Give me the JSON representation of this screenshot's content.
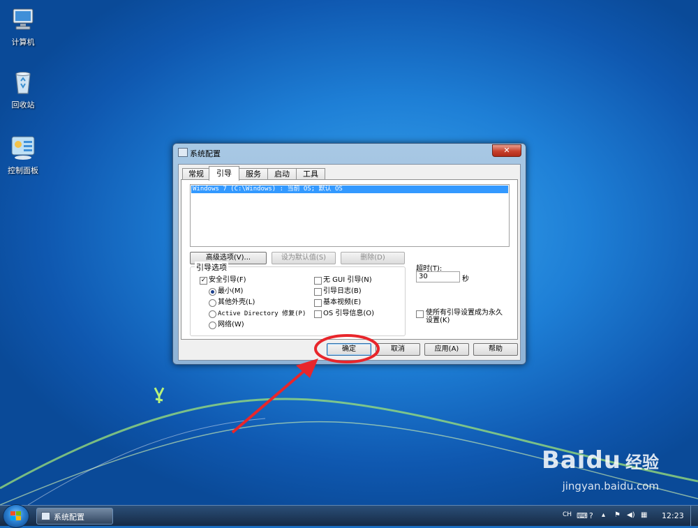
{
  "desktop": {
    "icons": [
      {
        "label": "计算机"
      },
      {
        "label": "回收站"
      },
      {
        "label": "控制面板"
      }
    ]
  },
  "dialog": {
    "title": "系统配置",
    "close": "✕",
    "tabs": [
      "常规",
      "引导",
      "服务",
      "启动",
      "工具"
    ],
    "active_tab": "引导",
    "os_entry": "Windows 7 (C:\\Windows) : 当前 OS; 默认 OS",
    "buttons": {
      "advanced": "高级选项(V)...",
      "set_default": "设为默认值(S)",
      "delete": "删除(D)"
    },
    "boot_options": {
      "group_label": "引导选项",
      "safe_boot": {
        "label": "安全引导(F)",
        "checked": true
      },
      "minimal": {
        "label": "最小(M)",
        "selected": true
      },
      "alternate_shell": {
        "label": "其他外壳(L)"
      },
      "ad_repair": {
        "label": "Active Directory 修复(P)"
      },
      "network": {
        "label": "网络(W)"
      },
      "no_gui": {
        "label": "无 GUI 引导(N)"
      },
      "boot_log": {
        "label": "引导日志(B)"
      },
      "base_video": {
        "label": "基本视频(E)"
      },
      "os_boot_info": {
        "label": "OS 引导信息(O)"
      }
    },
    "timeout": {
      "label": "超时(T):",
      "value": "30",
      "unit": "秒"
    },
    "permanent": {
      "label_line1": "使所有引导设置成为永久",
      "label_line2": "设置(K)"
    },
    "footer": {
      "ok": "确定",
      "cancel": "取消",
      "apply": "应用(A)",
      "help": "帮助"
    }
  },
  "taskbar": {
    "task_label": "系统配置",
    "tray_lang": "CH",
    "clock": "12:23"
  },
  "watermark": {
    "brand": "Baidu",
    "cn": "经验",
    "url": "jingyan.baidu.com"
  },
  "colors": {
    "selection": "#3399ff",
    "annotation": "#e8262b"
  }
}
